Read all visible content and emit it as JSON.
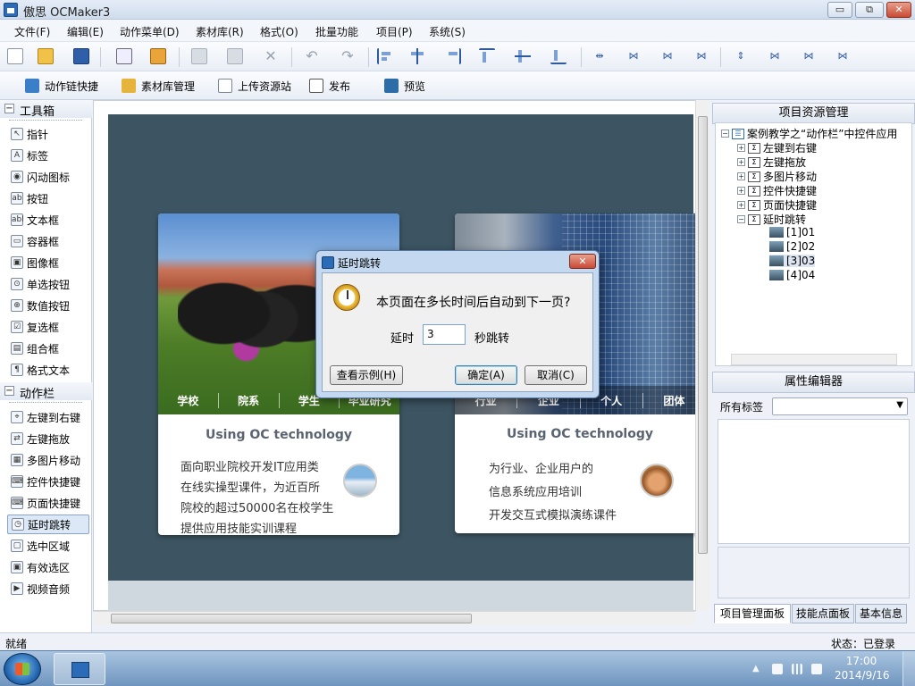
{
  "window": {
    "title": "傲思 OCMaker3",
    "min": "▭",
    "max": "⧉",
    "close": "✕"
  },
  "menu": [
    "文件(F)",
    "编辑(E)",
    "动作菜单(D)",
    "素材库(R)",
    "格式(O)",
    "批量功能",
    "项目(P)",
    "系统(S)"
  ],
  "toolbar2": [
    "动作链快捷",
    "素材库管理",
    "上传资源站",
    "发布",
    "预览"
  ],
  "left": {
    "section_toolbox": "工具箱",
    "section_actions": "动作栏",
    "tools": [
      "指针",
      "标签",
      "闪动图标",
      "按钮",
      "文本框",
      "容器框",
      "图像框",
      "单选按钮",
      "数值按钮",
      "复选框",
      "组合框",
      "格式文本"
    ],
    "actions": [
      "左键到右键",
      "左键拖放",
      "多图片移动",
      "控件快捷键",
      "页面快捷键",
      "延时跳转",
      "选中区域",
      "有效选区",
      "视频音频"
    ],
    "tool_icons": [
      "pointer-icon",
      "label-icon",
      "flash-icon",
      "button-icon",
      "textbox-icon",
      "container-icon",
      "image-icon",
      "radio-icon",
      "number-icon",
      "checkbox-icon",
      "combo-icon",
      "richtext-icon"
    ],
    "action_icons": [
      "mouse-icon",
      "drag-icon",
      "images-icon",
      "hotkey-icon",
      "page-hotkey-icon",
      "delay-jump-icon",
      "region-icon",
      "valid-region-icon",
      "video-icon"
    ]
  },
  "cards": [
    {
      "nav": [
        "学校",
        "院系",
        "学生",
        "毕业研究"
      ],
      "title": "Using OC technology",
      "lines": [
        "面向职业院校开发IT应用类",
        "在线实操型课件，为近百所",
        "院校的超过50000名在校学生",
        "提供应用技能实训课程"
      ]
    },
    {
      "nav": [
        "行业",
        "企业",
        "个人",
        "团体"
      ],
      "title": "Using OC technology",
      "lines": [
        "为行业、企业用户的",
        "信息系统应用培训",
        "开发交互式模拟演练课件"
      ]
    }
  ],
  "right": {
    "project_header": "项目资源管理",
    "tree": {
      "root": "案例教学之“动作栏”中控件应用",
      "items": [
        "左键到右键",
        "左键拖放",
        "多图片移动",
        "控件快捷键",
        "页面快捷键",
        "延时跳转"
      ],
      "pages": [
        "[1]01",
        "[2]02",
        "[3]03",
        "[4]04"
      ]
    },
    "prop_header": "属性编辑器",
    "prop_label": "所有标签",
    "tabs": [
      "项目管理面板",
      "技能点面板",
      "基本信息"
    ]
  },
  "dialog": {
    "title": "延时跳转",
    "question": "本页面在多长时间后自动到下一页?",
    "delay_label": "延时",
    "delay_value": "3",
    "delay_unit": "秒跳转",
    "btn_example": "查看示例(H)",
    "btn_ok": "确定(A)",
    "btn_cancel": "取消(C)"
  },
  "status": {
    "left": "就绪",
    "right": "状态：已登录"
  },
  "taskbar": {
    "time": "17:00",
    "date": "2014/9/16"
  }
}
